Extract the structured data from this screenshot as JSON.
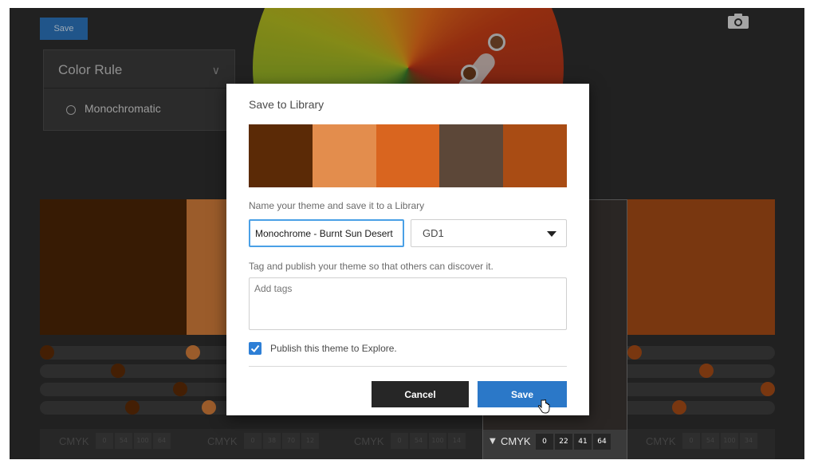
{
  "toolbar": {
    "save_label": "Save",
    "camera_icon": "camera-icon"
  },
  "color_rule": {
    "title": "Color Rule",
    "selected": "Monochromatic"
  },
  "background_palette": [
    "#4a2506",
    "#cf7b3a",
    "#b45a1a",
    "#3a2a21",
    "#a24a16"
  ],
  "cmyk_columns": [
    {
      "label": "CMYK",
      "values": [
        "0",
        "54",
        "100",
        "64"
      ]
    },
    {
      "label": "CMYK",
      "values": [
        "0",
        "38",
        "70",
        "12"
      ]
    },
    {
      "label": "CMYK",
      "values": [
        "0",
        "54",
        "100",
        "14"
      ]
    },
    {
      "label": "CMYK",
      "values": [
        "0",
        "22",
        "41",
        "64"
      ]
    },
    {
      "label": "CMYK",
      "values": [
        "0",
        "54",
        "100",
        "34"
      ]
    }
  ],
  "dialog": {
    "title": "Save to Library",
    "palette": [
      "#5b2a06",
      "#e38d4d",
      "#d9651f",
      "#5c4738",
      "#a94c14"
    ],
    "name_label": "Name your theme and save it to a Library",
    "theme_name": "Monochrome - Burnt Sun Desert",
    "library_value": "GD1",
    "tag_label": "Tag and publish your theme so that others can discover it.",
    "tags_placeholder": "Add tags",
    "publish_label": "Publish this theme to Explore.",
    "publish_checked": true,
    "cancel_label": "Cancel",
    "save_label": "Save"
  },
  "colors": {
    "primary": "#2b78c8",
    "dark_button": "#262626",
    "focus_border": "#4aa0e6"
  }
}
